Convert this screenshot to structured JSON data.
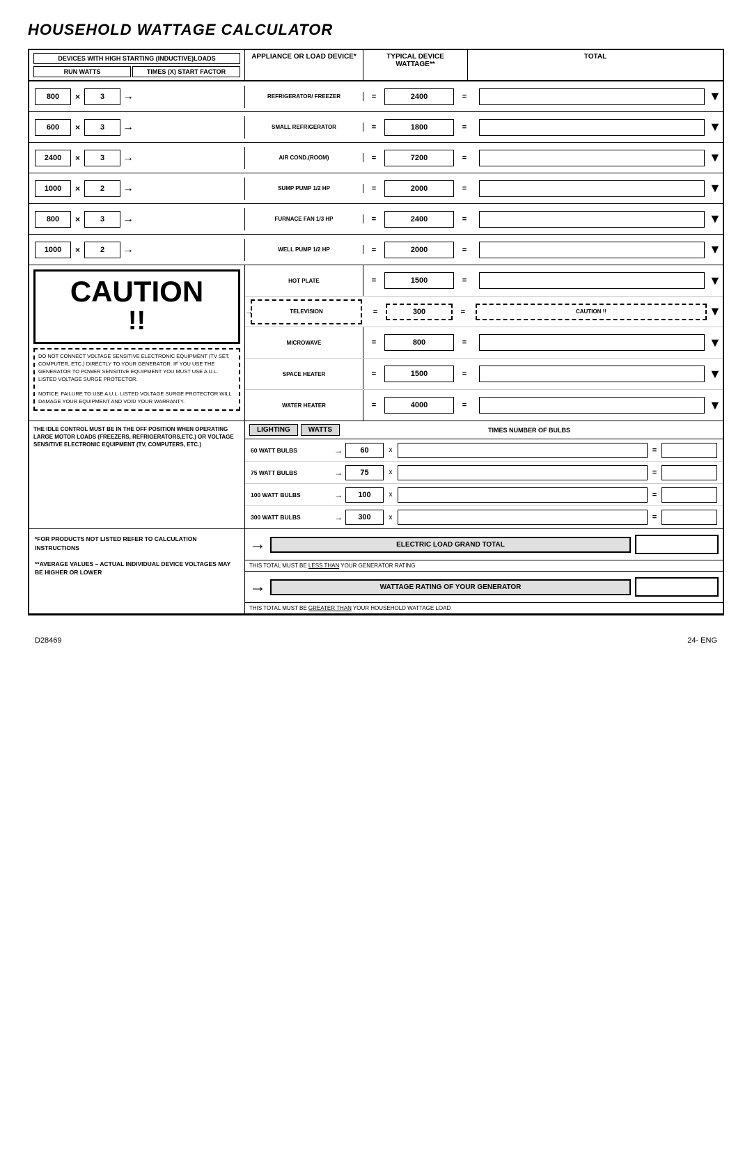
{
  "title": "HOUSEHOLD WATTAGE CALCULATOR",
  "header": {
    "col1": "DEVICES WITH HIGH STARTING (INDUCTIVE)LOADS",
    "col1_sub1": "RUN WATTS",
    "col1_sub2": "TIMES (X) START FACTOR",
    "col2": "APPLIANCE OR LOAD DEVICE*",
    "col3": "TYPICAL DEVICE WATTAGE**",
    "col4": "TOTAL"
  },
  "inductive_rows": [
    {
      "run_watts": "800",
      "times": "×",
      "factor": "3",
      "device": "REFRIGERATOR/ FREEZER",
      "wattage": "2400"
    },
    {
      "run_watts": "600",
      "times": "×",
      "factor": "3",
      "device": "SMALL REFRIGERATOR",
      "wattage": "1800"
    },
    {
      "run_watts": "2400",
      "times": "×",
      "factor": "3",
      "device": "AIR COND.(ROOM)",
      "wattage": "7200"
    },
    {
      "run_watts": "1000",
      "times": "×",
      "factor": "2",
      "device": "SUMP PUMP 1/2 HP",
      "wattage": "2000"
    },
    {
      "run_watts": "800",
      "times": "×",
      "factor": "3",
      "device": "FURNACE FAN 1/3 HP",
      "wattage": "2400"
    },
    {
      "run_watts": "1000",
      "times": "×",
      "factor": "2",
      "device": "WELL PUMP 1/2 HP",
      "wattage": "2000"
    }
  ],
  "caution": {
    "main_text": "CAUTION !!",
    "title": "CAUTION",
    "exclaim": "!!",
    "dashed_text": "DO NOT CONNECT VOLTAGE SENSITIVE ELECTRONIC EQUIPMENT (TV SET, COMPUTER, ETC.) DIRECTLY TO YOUR GENERATOR. IF YOU USE THE GENERATOR TO POWER SENSITIVE EQUIPMENT YOU MUST USE A U.L. LISTED VOLTAGE SURGE PROTECTOR.\n\nNOTICE: FAILURE TO USE A U.L. LISTED VOLTAGE SURGE PROTECTOR WILL DAMAGE YOUR EQUIPMENT AND VOID YOUR WARRANTY.",
    "right_box_text": "CAUTION !!"
  },
  "non_inductive_rows": [
    {
      "device": "HOT PLATE",
      "wattage": "1500"
    },
    {
      "device": "TELEVISION",
      "wattage": "300",
      "dashed": true
    },
    {
      "device": "MICROWAVE",
      "wattage": "800"
    },
    {
      "device": "SPACE HEATER",
      "wattage": "1500"
    },
    {
      "device": "WATER HEATER",
      "wattage": "4000"
    }
  ],
  "idle_note": "THE IDLE CONTROL MUST BE IN THE OFF POSITION WHEN OPERATING LARGE MOTOR LOADS (FREEZERS, REFRIGERATORS,ETC.) OR VOLTAGE SENSITIVE ELECTRONIC EQUIPMENT (TV, COMPUTERS, ETC.)",
  "lighting": {
    "title": "LIGHTING",
    "watts_header": "WATTS",
    "times_header": "TIMES NUMBER OF BULBS",
    "bulbs": [
      {
        "label": "60 WATT BULBS",
        "watts": "60"
      },
      {
        "label": "75 WATT BULBS",
        "watts": "75"
      },
      {
        "label": "100 WATT BULBS",
        "watts": "100"
      },
      {
        "label": "300 WATT BULBS",
        "watts": "300"
      }
    ]
  },
  "footer_left_1": "*FOR PRODUCTS NOT LISTED REFER TO CALCULATION INSTRUCTIONS",
  "footer_left_2": "**AVERAGE VALUES – ACTUAL INDIVIDUAL DEVICE VOLTAGES MAY BE HIGHER OR LOWER",
  "grand_total": {
    "label": "ELECTRIC LOAD GRAND TOTAL",
    "note": "THIS TOTAL MUST BE LESS THAN YOUR GENERATOR RATING"
  },
  "wattage_rating": {
    "label": "WATTAGE RATING OF YOUR GENERATOR",
    "note": "THIS TOTAL MUST BE GREATER THAN YOUR HOUSEHOLD WATTAGE LOAD"
  },
  "page_footer": {
    "left": "D28469",
    "right": "24- ENG"
  }
}
